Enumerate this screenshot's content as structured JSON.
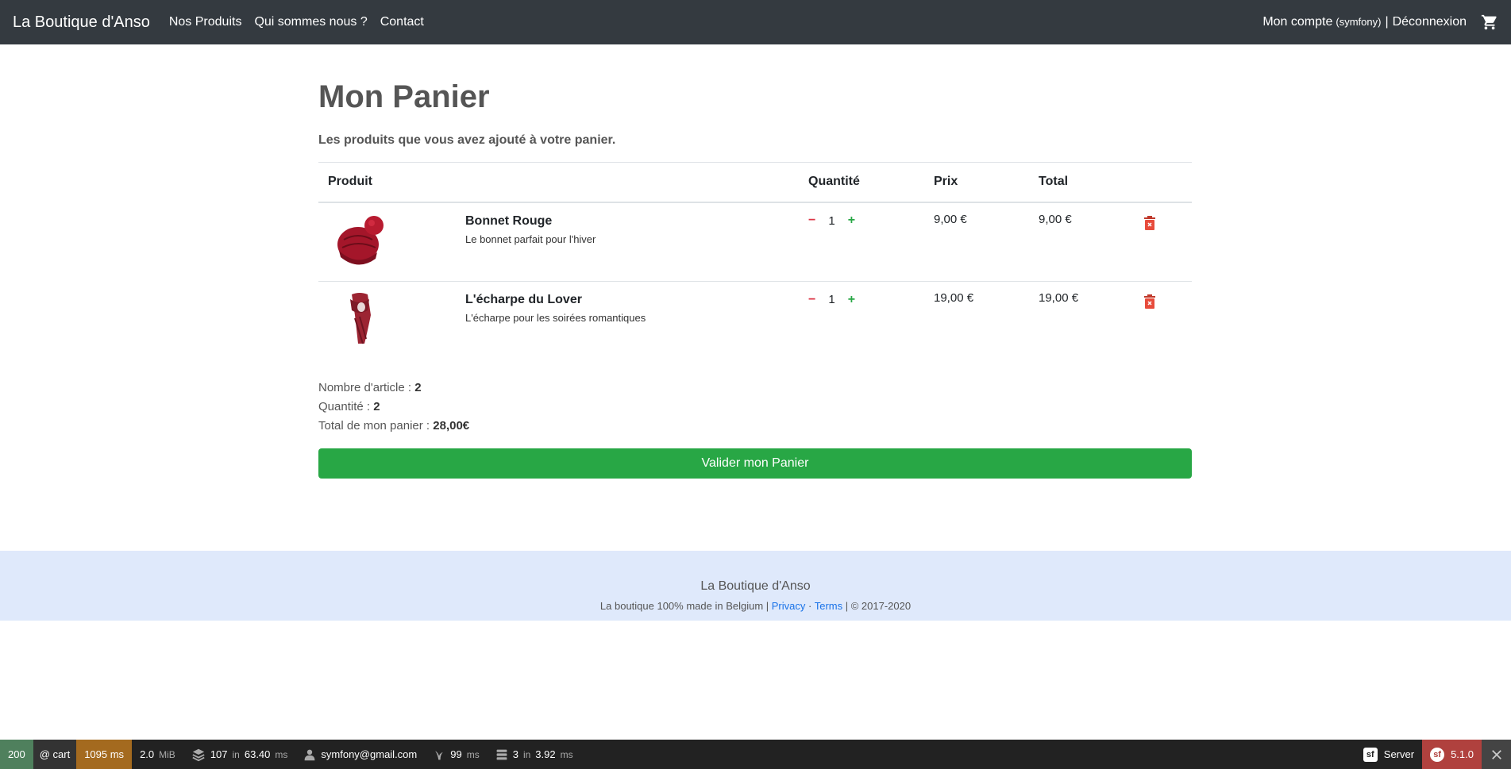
{
  "navbar": {
    "brand": "La Boutique d'Anso",
    "links": [
      "Nos Produits",
      "Qui sommes nous ?",
      "Contact"
    ],
    "account": "Mon compte",
    "account_user": "(symfony)",
    "separator": "|",
    "logout": "Déconnexion",
    "cart_icon": "cart-icon"
  },
  "main": {
    "title": "Mon Panier",
    "subtitle": "Les produits que vous avez ajouté à votre panier.",
    "table": {
      "headers": [
        "Produit",
        "Quantité",
        "Prix",
        "Total"
      ],
      "rows": [
        {
          "name": "Bonnet Rouge",
          "description": "Le bonnet parfait pour l'hiver",
          "minus": "−",
          "quantity": "1",
          "plus": "+",
          "price": "9,00 €",
          "total": "9,00 €"
        },
        {
          "name": "L'écharpe du Lover",
          "description": "L'écharpe pour les soirées romantiques",
          "minus": "−",
          "quantity": "1",
          "plus": "+",
          "price": "19,00 €",
          "total": "19,00 €"
        }
      ]
    },
    "summary": {
      "articles_label": "Nombre d'article : ",
      "articles_value": "2",
      "quantity_label": "Quantité : ",
      "quantity_value": "2",
      "total_label": "Total de mon panier : ",
      "total_value": "28,00€"
    },
    "validate_button": "Valider mon Panier"
  },
  "footer": {
    "title": "La Boutique d'Anso",
    "text": "La boutique 100% made in Belgium | ",
    "privacy": "Privacy",
    "dot": " · ",
    "terms": "Terms",
    "copyright": " | © 2017-2020"
  },
  "toolbar": {
    "status": "200",
    "route": "@ cart",
    "time": "1095 ms",
    "memory": "2.0",
    "memory_unit": "MiB",
    "db_queries": "107",
    "db_in": "in",
    "db_time": "63.40",
    "db_unit": "ms",
    "user": "symfony@gmail.com",
    "twig_time": "99",
    "twig_unit": "ms",
    "cache_calls": "3",
    "cache_in": "in",
    "cache_time": "3.92",
    "cache_unit": "ms",
    "server": "Server",
    "version": "5.1.0"
  },
  "colors": {
    "navbar_bg": "#343a40",
    "success": "#28a745",
    "danger": "#dc3545",
    "footer_bg": "#dfe9fb"
  }
}
